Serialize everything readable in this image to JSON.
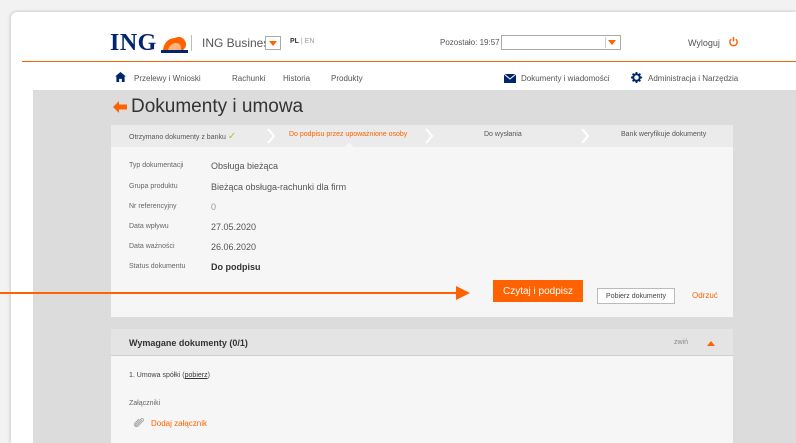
{
  "header": {
    "logo_text": "ING",
    "business_label": "ING Business",
    "lang_active": "PL",
    "lang_sep": " | ",
    "lang_other": "EN",
    "remaining": "Pozostało: 19:57",
    "account_select_value": "",
    "logout": "Wyloguj"
  },
  "nav": {
    "items": [
      "Przelewy i Wnioski",
      "Rachunki",
      "Historia",
      "Produkty"
    ],
    "documents": "Dokumenty i wiadomości",
    "admin": "Administracja i Narzędzia"
  },
  "page": {
    "title": "Dokumenty i umowa"
  },
  "steps": [
    {
      "label": "Otrzymano dokumenty z banku",
      "state": "done"
    },
    {
      "label": "Do podpisu przez upoważnione osoby",
      "state": "active"
    },
    {
      "label": "Do wysłania",
      "state": "todo"
    },
    {
      "label": "Bank weryfikuje dokumenty",
      "state": "todo"
    }
  ],
  "info": {
    "doc_type_label": "Typ dokumentacji",
    "doc_type": "Obsługa bieżąca",
    "product_group_label": "Grupa produktu",
    "product_group": "Bieżąca obsługa-rachunki dla firm",
    "ref_no_label": "Nr referencyjny",
    "ref_no": "0",
    "received_label": "Data wpływu",
    "received": "27.05.2020",
    "valid_label": "Data ważności",
    "valid": "26.06.2020",
    "status_label": "Status dokumentu",
    "status": "Do podpisu"
  },
  "actions": {
    "sign": "Czytaj i podpisz",
    "download": "Pobierz dokumenty",
    "reject": "Odrzuć"
  },
  "required": {
    "title": "Wymagane dokumenty (0/1)",
    "collapse": "zwiń",
    "doc_prefix": "1. Umowa spółki (",
    "doc_link": "pobierz",
    "doc_suffix": ")",
    "attachments_label": "Załączniki",
    "add_attachment": "Dodaj załącznik"
  },
  "colors": {
    "accent": "#ff6200",
    "brand": "#00266d"
  }
}
